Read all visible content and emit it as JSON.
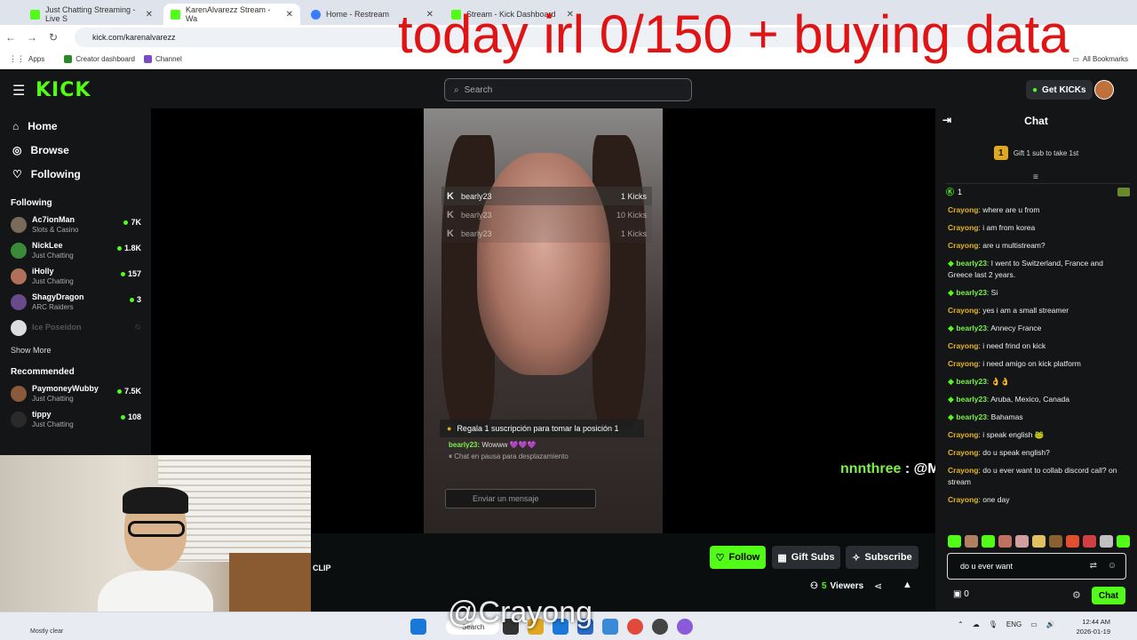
{
  "browser": {
    "tabs": [
      {
        "label": "Just Chatting Streaming - Live S",
        "color": "#53fc18"
      },
      {
        "label": "KarenAlvarezz Stream - Wa",
        "color": "#53fc18",
        "active": true
      },
      {
        "label": "Home - Restream",
        "color": "#3b7bff"
      },
      {
        "label": "Stream - Kick Dashboard",
        "color": "#53fc18"
      }
    ],
    "url": "kick.com/karenalvarezz",
    "bookmarks": [
      "Apps",
      "Creator dashboard",
      "Channel"
    ],
    "all_bookmarks": "All Bookmarks"
  },
  "overlay": {
    "title": "today irl 0/150 + buying data",
    "user_line_name": "nnnthree",
    "user_line_rest": " : @MsHaunter KEK",
    "crayong": "@Crayong"
  },
  "header": {
    "logo": "KICK",
    "search_placeholder": "Search",
    "get_kicks": "Get KICKs"
  },
  "sidebar": {
    "nav": [
      {
        "label": "Home",
        "icon": "home-icon"
      },
      {
        "label": "Browse",
        "icon": "compass-icon"
      },
      {
        "label": "Following",
        "icon": "heart-icon"
      }
    ],
    "following_title": "Following",
    "following": [
      {
        "name": "Ac7ionMan",
        "category": "Slots & Casino",
        "viewers": "7K",
        "color": "#7a6a5a"
      },
      {
        "name": "NickLee",
        "category": "Just Chatting",
        "viewers": "1.8K",
        "color": "#3a8a3a"
      },
      {
        "name": "iHolly",
        "category": "Just Chatting",
        "viewers": "157",
        "color": "#b0705a"
      },
      {
        "name": "ShagyDragon",
        "category": "ARC Raiders",
        "viewers": "3",
        "color": "#6a4a8a"
      }
    ],
    "offline": {
      "name": "Ice Poseidon"
    },
    "show_more": "Show More",
    "recommended_title": "Recommended",
    "recommended": [
      {
        "name": "PaymoneyWubby",
        "category": "Just Chatting",
        "viewers": "7.5K",
        "color": "#8a5a3a"
      },
      {
        "name": "tippy",
        "category": "Just Chatting",
        "viewers": "108",
        "color": "#2a2a2a"
      }
    ]
  },
  "video": {
    "kicks": [
      {
        "user": "bearly23",
        "amount": "1 Kicks"
      },
      {
        "user": "bearly23",
        "amount": "10 Kicks"
      },
      {
        "user": "bearly23",
        "amount": "1 Kicks"
      }
    ],
    "gift_banner": "Regala 1 suscripción para tomar la posición 1",
    "mini_msg_user": "bearly23:",
    "mini_msg_text": "Wowww 💜💜💜",
    "mini_paused": "Chat en pausa para desplazamiento",
    "mini_input_placeholder": "Enviar un mensaje"
  },
  "actions": {
    "clip": "CLIP",
    "follow": "Follow",
    "gift_subs": "Gift Subs",
    "subscribe": "Subscribe",
    "viewers_count": "5",
    "viewers_label": "Viewers"
  },
  "chat": {
    "title": "Chat",
    "gift_prompt": "Gift 1 sub to take 1st",
    "pinned_count": "1",
    "messages": [
      {
        "user": "Crayong",
        "text": "where are u from",
        "vip": false
      },
      {
        "user": "Crayong",
        "text": "i am from korea",
        "vip": false
      },
      {
        "user": "Crayong",
        "text": "are u multistream?",
        "vip": false
      },
      {
        "user": "bearly23",
        "text": "I went to Switzerland, France and Greece last 2 years.",
        "vip": true
      },
      {
        "user": "bearly23",
        "text": "Si",
        "vip": true
      },
      {
        "user": "Crayong",
        "text": "yes i am a small streamer",
        "vip": false
      },
      {
        "user": "bearly23",
        "text": "Annecy France",
        "vip": true
      },
      {
        "user": "Crayong",
        "text": "i need frind on kick",
        "vip": false
      },
      {
        "user": "Crayong",
        "text": "i need amigo on kick platform",
        "vip": false
      },
      {
        "user": "bearly23",
        "text": "👌👌",
        "vip": true
      },
      {
        "user": "bearly23",
        "text": "Aruba, Mexico, Canada",
        "vip": true
      },
      {
        "user": "bearly23",
        "text": "Bahamas",
        "vip": true
      },
      {
        "user": "Crayong",
        "text": "i speak english 🐸",
        "vip": false
      },
      {
        "user": "Crayong",
        "text": "do u speak english?",
        "vip": false
      },
      {
        "user": "Crayong",
        "text": "do u ever want to collab discord call? on stream",
        "vip": false
      },
      {
        "user": "Crayong",
        "text": "one day",
        "vip": false
      }
    ],
    "input_value": "do u ever want",
    "points": "0",
    "send": "Chat"
  },
  "taskbar": {
    "weather": "Mostly clear",
    "search": "Search",
    "lang": "ENG",
    "time": "12:44 AM",
    "date": "2026-01-19"
  }
}
